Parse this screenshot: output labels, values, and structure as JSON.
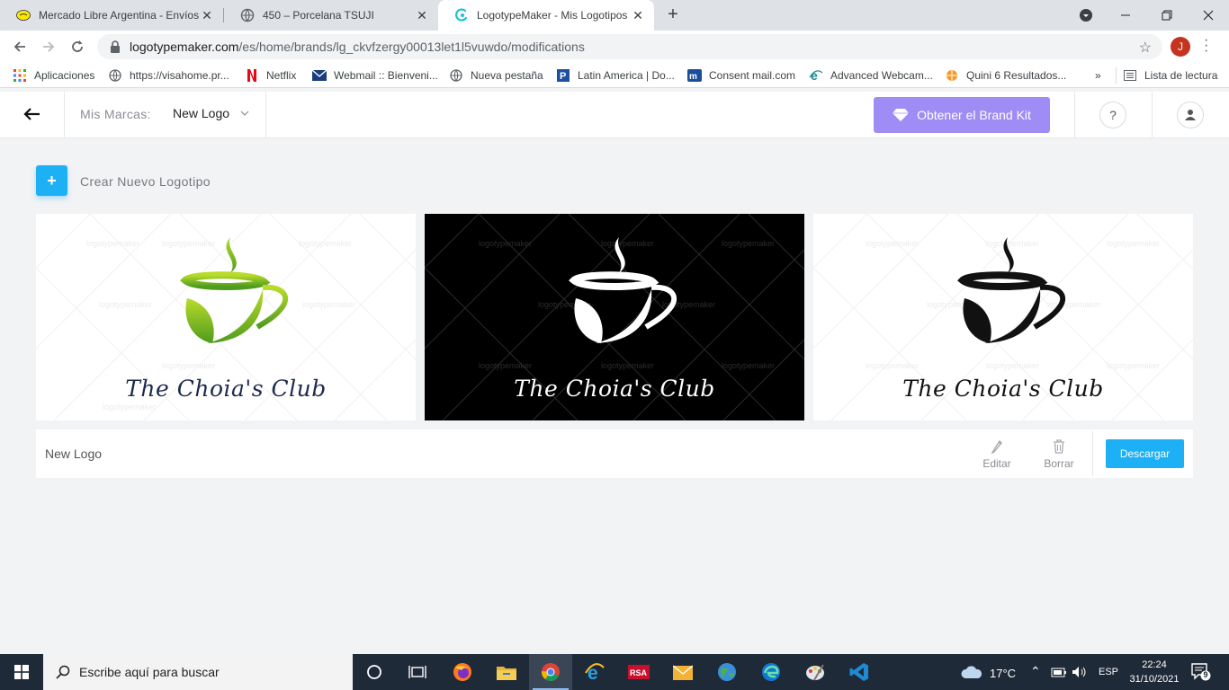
{
  "browser": {
    "tabs": [
      {
        "title": "Mercado Libre Argentina - Envíos",
        "icon": "mercadolibre-icon"
      },
      {
        "title": "450 – Porcelana TSUJI",
        "icon": "globe-icon"
      },
      {
        "title": "LogotypeMaker - Mis Logotipos",
        "icon": "logotypemaker-icon",
        "active": true
      }
    ],
    "url_host": "logotypemaker.com",
    "url_path": "/es/home/brands/lg_ckvfzergy00013let1l5vuwdo/modifications",
    "profile_initial": "J",
    "bookmarks": [
      {
        "label": "Aplicaciones",
        "icon": "apps-grid-icon"
      },
      {
        "label": "https://visahome.pr...",
        "icon": "globe-icon"
      },
      {
        "label": "Netflix",
        "icon": "netflix-icon"
      },
      {
        "label": "Webmail :: Bienveni...",
        "icon": "webmail-icon"
      },
      {
        "label": "Nueva pestaña",
        "icon": "globe-icon"
      },
      {
        "label": "Latin America | Do...",
        "icon": "paypal-icon"
      },
      {
        "label": "Consent mail.com",
        "icon": "mail-com-icon"
      },
      {
        "label": "Advanced Webcam...",
        "icon": "ie-icon"
      },
      {
        "label": "Quini 6 Resultados...",
        "icon": "ball-icon"
      }
    ],
    "reading_list": "Lista de lectura"
  },
  "app": {
    "brands_label": "Mis Marcas:",
    "brand_selected": "New Logo",
    "brand_kit_button": "Obtener el Brand Kit",
    "help_symbol": "?",
    "create_label": "Crear Nuevo Logotipo",
    "create_symbol": "+",
    "watermark": "logotypemaker",
    "logos": [
      {
        "text": "The Choia's Club",
        "variant": "color",
        "background": "#ffffff",
        "text_color": "#1d2a4d"
      },
      {
        "text": "The Choia's Club",
        "variant": "inverted",
        "background": "#000000",
        "text_color": "#ffffff"
      },
      {
        "text": "The Choia's Club",
        "variant": "mono",
        "background": "#ffffff",
        "text_color": "#111111"
      }
    ],
    "logo_name": "New Logo",
    "edit_label": "Editar",
    "delete_label": "Borrar",
    "download_label": "Descargar",
    "accent_color": "#1eb0f5",
    "brand_kit_color": "#a08cf5"
  },
  "taskbar": {
    "search_placeholder": "Escribe aquí para buscar",
    "weather": "17°C",
    "language": "ESP",
    "time": "22:24",
    "date": "31/10/2021",
    "notifications": "9"
  }
}
